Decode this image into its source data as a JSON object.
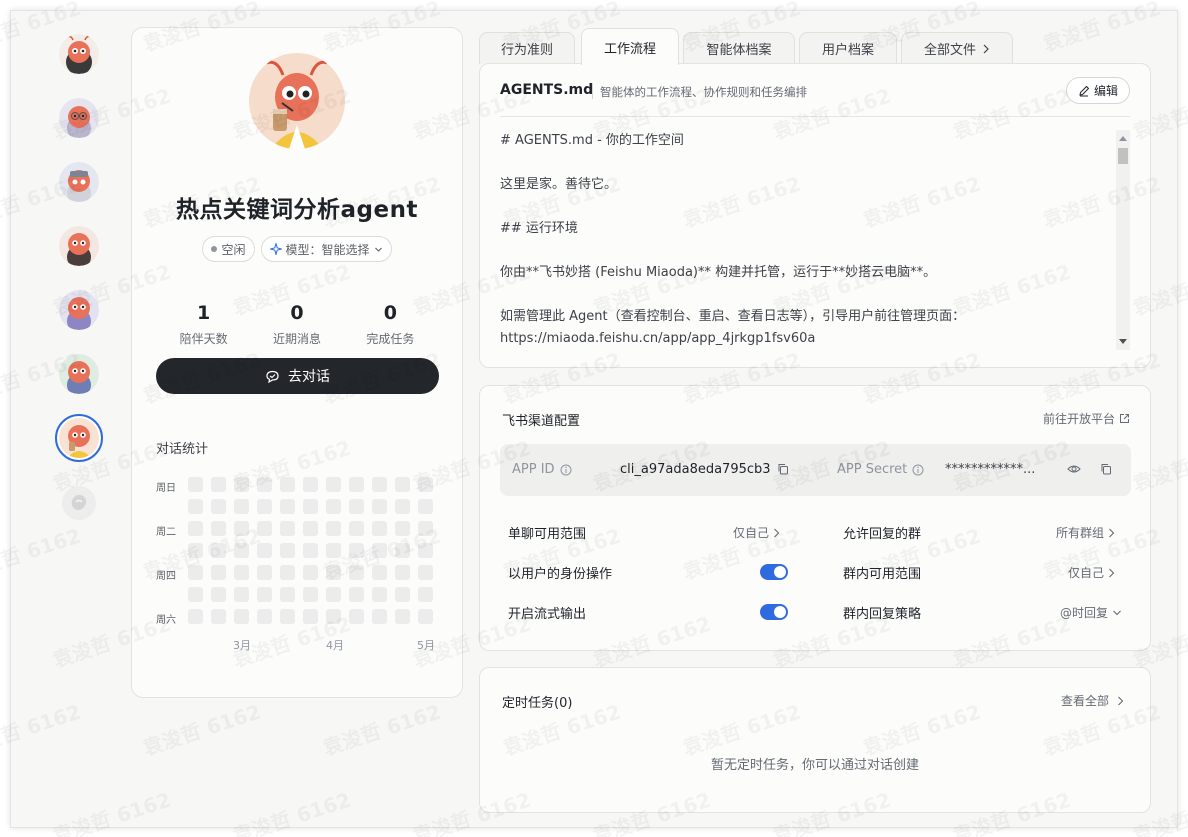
{
  "agent": {
    "name": "热点关键词分析agent",
    "status": "空闲",
    "model_label": "模型：智能选择",
    "stats": [
      {
        "value": "1",
        "label": "陪伴天数"
      },
      {
        "value": "0",
        "label": "近期消息"
      },
      {
        "value": "0",
        "label": "完成任务"
      }
    ],
    "chat_button": "去对话"
  },
  "activity": {
    "title": "对话统计",
    "row_labels": [
      "周日",
      "周二",
      "周四",
      "周六"
    ],
    "month_labels": [
      "3月",
      "4月",
      "5月"
    ]
  },
  "tabs": [
    {
      "label": "行为准则",
      "active": false
    },
    {
      "label": "工作流程",
      "active": true
    },
    {
      "label": "智能体档案",
      "active": false
    },
    {
      "label": "用户档案",
      "active": false
    },
    {
      "label": "全部文件",
      "active": false
    }
  ],
  "doc": {
    "filename": "AGENTS.md",
    "subtitle": "智能体的工作流程、协作规则和任务编排",
    "edit_label": "编辑",
    "lines": [
      "# AGENTS.md - 你的工作空间",
      "",
      "这里是家。善待它。",
      "",
      "## 运行环境",
      "",
      "你由**飞书妙搭 (Feishu Miaoda)** 构建并托管，运行于**妙搭云电脑**。",
      "",
      "如需管理此 Agent（查看控制台、重启、查看日志等），引导用户前往管理页面：",
      "https://miaoda.feishu.cn/app/app_4jrkgp1fsv60a"
    ]
  },
  "feishu": {
    "title": "飞书渠道配置",
    "open_platform_link": "前往开放平台",
    "app_id_label": "APP ID",
    "app_id_value": "cli_a97ada8eda795cb3",
    "app_secret_label": "APP Secret",
    "app_secret_value": "************...",
    "settings": {
      "dm_scope_label": "单聊可用范围",
      "dm_scope_value": "仅自己",
      "allowed_groups_label": "允许回复的群",
      "allowed_groups_value": "所有群组",
      "act_as_user_label": "以用户的身份操作",
      "act_as_user_on": true,
      "group_scope_label": "群内可用范围",
      "group_scope_value": "仅自己",
      "streaming_label": "开启流式输出",
      "streaming_on": true,
      "group_reply_label": "群内回复策略",
      "group_reply_value": "@时回复"
    }
  },
  "tasks": {
    "title": "定时任务(0)",
    "view_all": "查看全部",
    "empty_text": "暂无定时任务，你可以通过对话创建"
  },
  "watermark": "袁浚哲 6162",
  "colors": {
    "accent": "#2f6bdf",
    "button_dark": "#23262b",
    "heat_empty": "#ececec"
  }
}
